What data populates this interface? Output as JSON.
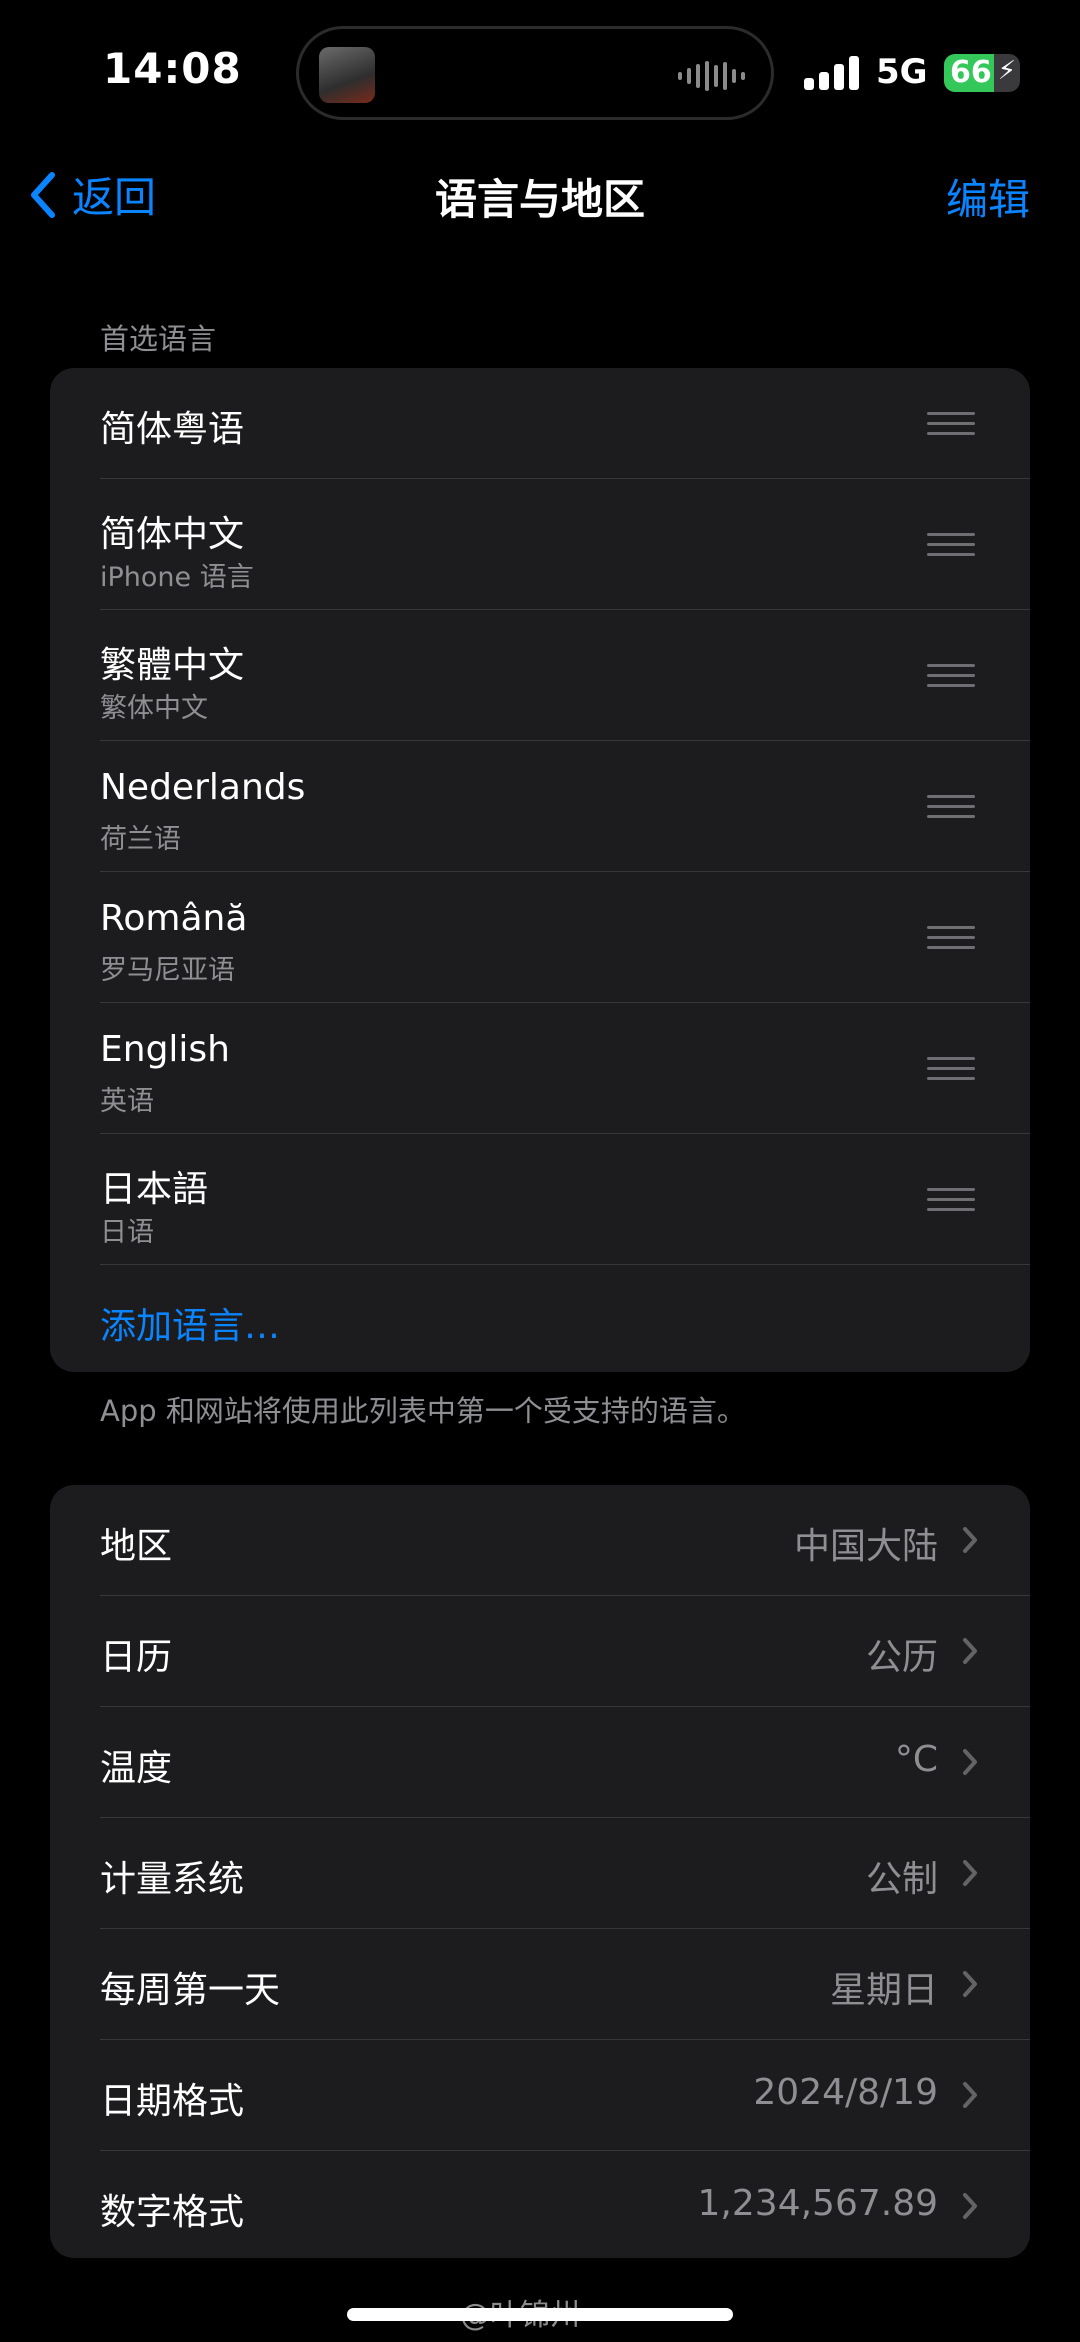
{
  "status_bar": {
    "time": "14:08",
    "network": "5G",
    "battery_percent": "66",
    "battery_level": 0.66,
    "signal_bars": 4
  },
  "nav": {
    "back_label": "返回",
    "title": "语言与地区",
    "edit_label": "编辑"
  },
  "preferred_languages": {
    "section_label": "首选语言",
    "items": [
      {
        "title": "简体粤语",
        "subtitle": ""
      },
      {
        "title": "简体中文",
        "subtitle": "iPhone 语言"
      },
      {
        "title": "繁體中文",
        "subtitle": "繁体中文"
      },
      {
        "title": "Nederlands",
        "subtitle": "荷兰语"
      },
      {
        "title": "Română",
        "subtitle": "罗马尼亚语"
      },
      {
        "title": "English",
        "subtitle": "英语"
      },
      {
        "title": "日本語",
        "subtitle": "日语"
      }
    ],
    "add_label": "添加语言…",
    "footnote": "App 和网站将使用此列表中第一个受支持的语言。"
  },
  "settings": {
    "items": [
      {
        "label": "地区",
        "value": "中国大陆"
      },
      {
        "label": "日历",
        "value": "公历"
      },
      {
        "label": "温度",
        "value": "°C"
      },
      {
        "label": "计量系统",
        "value": "公制"
      },
      {
        "label": "每周第一天",
        "value": "星期日"
      },
      {
        "label": "日期格式",
        "value": "2024/8/19"
      },
      {
        "label": "数字格式",
        "value": "1,234,567.89"
      }
    ]
  },
  "watermark": "@叶锦州",
  "colors": {
    "accent": "#0a84ff",
    "background": "#000000",
    "group_background": "#1c1c1e",
    "secondary_text": "#8e8e93",
    "battery_green": "#34c759"
  }
}
